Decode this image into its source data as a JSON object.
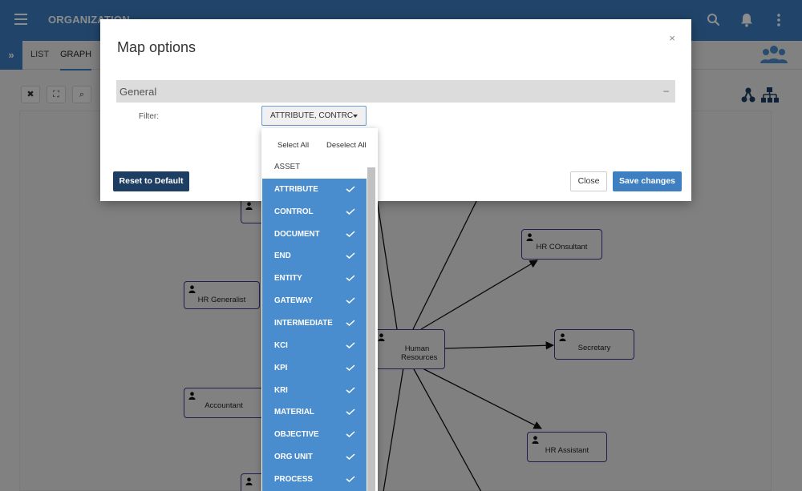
{
  "app": {
    "title": "ORGANIZATION"
  },
  "tabs": [
    {
      "label": "LIST"
    },
    {
      "label": "GRAPH"
    }
  ],
  "graph": {
    "nodes": [
      {
        "label": "HR Generalist"
      },
      {
        "label": "Accountant"
      },
      {
        "label": "Human Resources"
      },
      {
        "label": "HR COnsultant"
      },
      {
        "label": "Secretary"
      },
      {
        "label": "HR Assistant"
      }
    ]
  },
  "modal": {
    "title": "Map options",
    "close_glyph": "×",
    "section_title": "General",
    "section_toggle": "–",
    "filter_label": "Filter:",
    "filter_value": "ATTRIBUTE, CONTRC",
    "reset_label": "Reset to Default",
    "close_label": "Close",
    "save_label": "Save changes"
  },
  "dropdown": {
    "select_all": "Select All",
    "deselect_all": "Deselect All",
    "items": [
      {
        "label": "ASSET",
        "selected": false
      },
      {
        "label": "ATTRIBUTE",
        "selected": true
      },
      {
        "label": "CONTROL",
        "selected": true
      },
      {
        "label": "DOCUMENT",
        "selected": true
      },
      {
        "label": "END",
        "selected": true
      },
      {
        "label": "ENTITY",
        "selected": true
      },
      {
        "label": "GATEWAY",
        "selected": true
      },
      {
        "label": "INTERMEDIATE",
        "selected": true
      },
      {
        "label": "KCI",
        "selected": true
      },
      {
        "label": "KPI",
        "selected": true
      },
      {
        "label": "KRI",
        "selected": true
      },
      {
        "label": "MATERIAL",
        "selected": true
      },
      {
        "label": "OBJECTIVE",
        "selected": true
      },
      {
        "label": "ORG UNIT",
        "selected": true
      },
      {
        "label": "PROCESS",
        "selected": true
      }
    ]
  },
  "colors": {
    "app_bar": "#3d7fc1",
    "selected_item": "#4a8dce",
    "reset_button": "#1d3d63",
    "node_border": "#3a3a8a"
  },
  "icons": [
    "menu-icon",
    "search-icon",
    "bell-icon",
    "more-vert-icon",
    "people-icon",
    "hierarchy-icon",
    "org-chart-icon",
    "person-icon",
    "check-icon",
    "caret-down-icon"
  ]
}
